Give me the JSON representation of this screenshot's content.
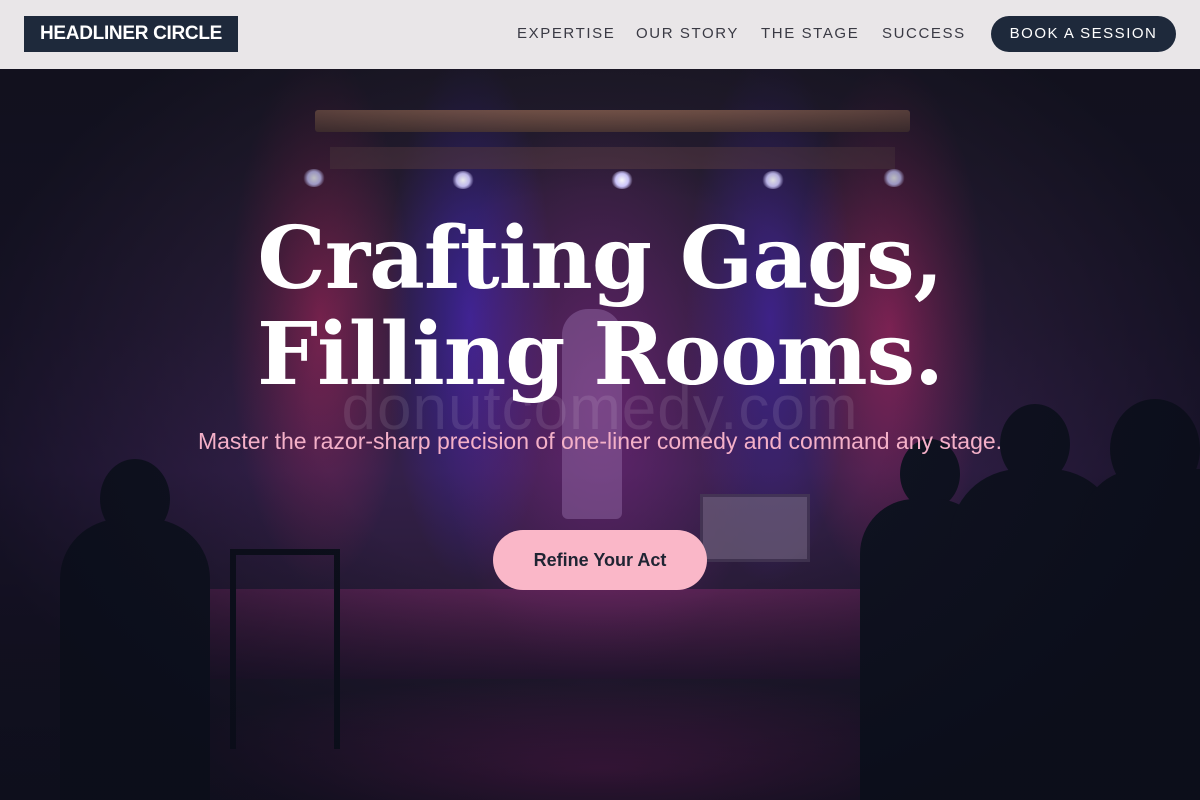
{
  "header": {
    "logo": "HEADLINER CIRCLE",
    "nav": [
      "EXPERTISE",
      "OUR STORY",
      "THE STAGE",
      "SUCCESS"
    ],
    "cta_label": "BOOK A SESSION"
  },
  "hero": {
    "title_line1": "Crafting Gags,",
    "title_line2": "Filling Rooms.",
    "watermark": "donutcomedy.com",
    "subtitle": "Master the razor-sharp precision of one-liner comedy and command any stage.",
    "cta_label": "Refine Your Act"
  },
  "colors": {
    "header_bg": "#e9e6e8",
    "navy": "#1e293b",
    "accent_pink": "#fab7c8",
    "subtitle_pink": "#f4b0c8"
  }
}
